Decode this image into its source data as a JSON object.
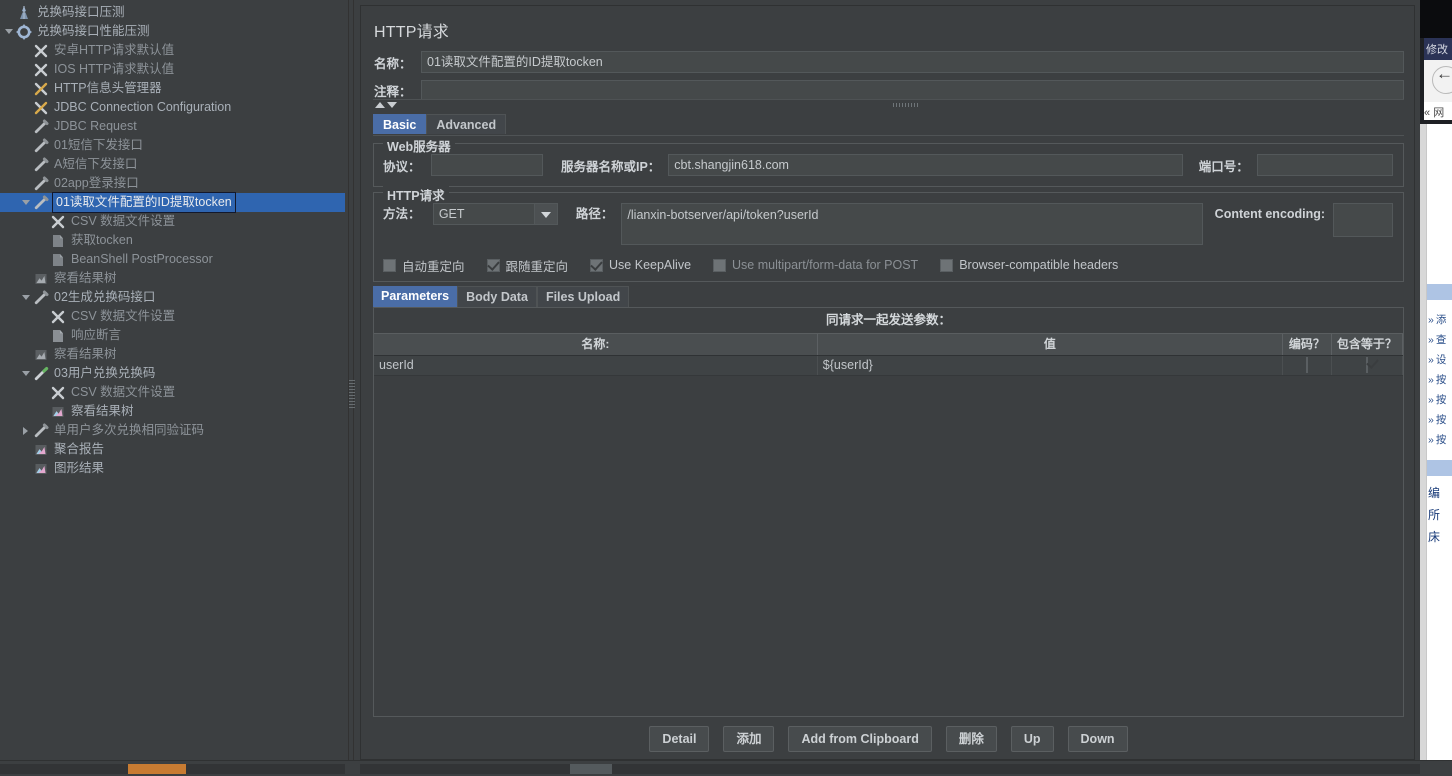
{
  "tree": {
    "nodes": [
      {
        "label": "兑换码接口压测",
        "depth": 0,
        "icon": "test-plan-icon",
        "toggle": "none",
        "dim": false
      },
      {
        "label": "兑换码接口性能压测",
        "depth": 0,
        "icon": "thread-group-icon",
        "toggle": "open",
        "dim": false
      },
      {
        "label": "安卓HTTP请求默认值",
        "depth": 1,
        "icon": "config-element-icon",
        "toggle": "none",
        "dim": true
      },
      {
        "label": "IOS HTTP请求默认值",
        "depth": 1,
        "icon": "config-element-icon",
        "toggle": "none",
        "dim": true
      },
      {
        "label": "HTTP信息头管理器",
        "depth": 1,
        "icon": "header-manager-icon",
        "toggle": "none",
        "dim": false
      },
      {
        "label": "JDBC Connection Configuration",
        "depth": 1,
        "icon": "header-manager-icon",
        "toggle": "none",
        "dim": false
      },
      {
        "label": "JDBC Request",
        "depth": 1,
        "icon": "sampler-icon",
        "toggle": "none",
        "dim": true
      },
      {
        "label": "01短信下发接口",
        "depth": 1,
        "icon": "sampler-icon",
        "toggle": "none",
        "dim": true
      },
      {
        "label": "A短信下发接口",
        "depth": 1,
        "icon": "sampler-icon",
        "toggle": "none",
        "dim": true
      },
      {
        "label": "02app登录接口",
        "depth": 1,
        "icon": "sampler-icon",
        "toggle": "none",
        "dim": true
      },
      {
        "label": "01读取文件配置的ID提取tocken",
        "depth": 1,
        "icon": "sampler-icon",
        "toggle": "open",
        "dim": false,
        "selected": true
      },
      {
        "label": "CSV 数据文件设置",
        "depth": 2,
        "icon": "config-element-icon",
        "toggle": "none",
        "dim": true
      },
      {
        "label": "获取tocken",
        "depth": 2,
        "icon": "post-processor-icon",
        "toggle": "none",
        "dim": true
      },
      {
        "label": "BeanShell PostProcessor",
        "depth": 2,
        "icon": "post-processor-icon",
        "toggle": "none",
        "dim": true
      },
      {
        "label": "察看结果树",
        "depth": 1,
        "icon": "listener-icon",
        "toggle": "none",
        "dim": true
      },
      {
        "label": "02生成兑换码接口",
        "depth": 1,
        "icon": "sampler-icon",
        "toggle": "open",
        "dim": false
      },
      {
        "label": "CSV 数据文件设置",
        "depth": 2,
        "icon": "config-element-icon",
        "toggle": "none",
        "dim": true
      },
      {
        "label": "响应断言",
        "depth": 2,
        "icon": "assertion-icon",
        "toggle": "none",
        "dim": true
      },
      {
        "label": "察看结果树",
        "depth": 1,
        "icon": "listener-icon",
        "toggle": "none",
        "dim": true
      },
      {
        "label": "03用户兑换兑换码",
        "depth": 1,
        "icon": "sampler-active-icon",
        "toggle": "open",
        "dim": false
      },
      {
        "label": "CSV 数据文件设置",
        "depth": 2,
        "icon": "config-element-icon",
        "toggle": "none",
        "dim": true
      },
      {
        "label": "察看结果树",
        "depth": 2,
        "icon": "listener-active-icon",
        "toggle": "none",
        "dim": false
      },
      {
        "label": "单用户多次兑换相同验证码",
        "depth": 1,
        "icon": "sampler-icon",
        "toggle": "closed",
        "dim": true
      },
      {
        "label": "聚合报告",
        "depth": 1,
        "icon": "listener-active-icon",
        "toggle": "none",
        "dim": false
      },
      {
        "label": "图形结果",
        "depth": 1,
        "icon": "listener-active-icon",
        "toggle": "none",
        "dim": false
      }
    ]
  },
  "editor": {
    "title": "HTTP请求",
    "name_label": "名称：",
    "name_value": "01读取文件配置的ID提取tocken",
    "comment_label": "注释：",
    "comment_value": "",
    "tabs": [
      {
        "label": "Basic",
        "active": true
      },
      {
        "label": "Advanced",
        "active": false
      }
    ],
    "web_server": {
      "group_title": "Web服务器",
      "protocol_label": "协议：",
      "protocol_value": "",
      "server_label": "服务器名称或IP：",
      "server_value": "cbt.shangjin618.com",
      "port_label": "端口号：",
      "port_value": ""
    },
    "http_request": {
      "group_title": "HTTP请求",
      "method_label": "方法：",
      "method_value": "GET",
      "path_label": "路径：",
      "path_value": "/lianxin-botserver/api/token?userId",
      "encoding_label": "Content encoding:",
      "encoding_value": ""
    },
    "options": [
      {
        "label": "自动重定向",
        "checked": false,
        "dim": false
      },
      {
        "label": "跟随重定向",
        "checked": true,
        "dim": false
      },
      {
        "label": "Use KeepAlive",
        "checked": true,
        "dim": false
      },
      {
        "label": "Use multipart/form-data for POST",
        "checked": false,
        "dim": true
      },
      {
        "label": "Browser-compatible headers",
        "checked": false,
        "dim": false
      }
    ],
    "param_tabs": [
      {
        "label": "Parameters",
        "active": true
      },
      {
        "label": "Body Data",
        "active": false
      },
      {
        "label": "Files Upload",
        "active": false
      }
    ],
    "params_table": {
      "caption": "同请求一起发送参数：",
      "columns": [
        "名称:",
        "值",
        "编码？",
        "包含等于？"
      ],
      "rows": [
        {
          "name": "userId",
          "value": "${userId}",
          "encode": false,
          "include_equals": true
        }
      ]
    },
    "buttons": [
      {
        "label": "Detail"
      },
      {
        "label": "添加"
      },
      {
        "label": "Add from Clipboard"
      },
      {
        "label": "删除"
      },
      {
        "label": "Up"
      },
      {
        "label": "Down"
      }
    ]
  },
  "background_window": {
    "titlebar_text": "修改",
    "address_text": "网",
    "list_items": [
      "添",
      "查",
      "设",
      "按",
      "按",
      "按",
      "按"
    ],
    "footer_lines": [
      "编",
      "所",
      "床"
    ]
  },
  "colors": {
    "accent_selection": "#2f65b0",
    "tab_active": "#4a6da7",
    "panel_bg": "#3c3f41",
    "field_bg": "#45494a",
    "scrollbar_thumb": "#c77b32"
  }
}
